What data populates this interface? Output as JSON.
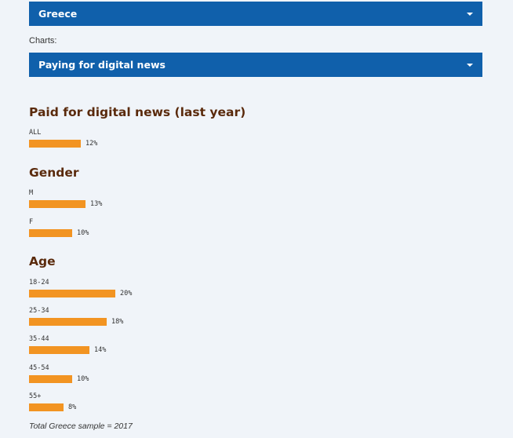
{
  "filters": {
    "country": "Greece",
    "charts_label": "Charts:",
    "chart": "Paying for digital news"
  },
  "chart_data": {
    "type": "bar",
    "orientation": "horizontal",
    "unit": "%",
    "color": "#f29422",
    "title_color": "#5a2a0c",
    "groups": [
      {
        "title": "Paid for digital news (last year)",
        "categories": [
          "ALL"
        ],
        "values": [
          12
        ],
        "value_labels": [
          "12%"
        ]
      },
      {
        "title": "Gender",
        "categories": [
          "M",
          "F"
        ],
        "values": [
          13,
          10
        ],
        "value_labels": [
          "13%",
          "10%"
        ]
      },
      {
        "title": "Age",
        "categories": [
          "18-24",
          "25-34",
          "35-44",
          "45-54",
          "55+"
        ],
        "values": [
          20,
          18,
          14,
          10,
          8
        ],
        "value_labels": [
          "20%",
          "18%",
          "14%",
          "10%",
          "8%"
        ]
      }
    ]
  },
  "footnote": "Total Greece sample = 2017"
}
